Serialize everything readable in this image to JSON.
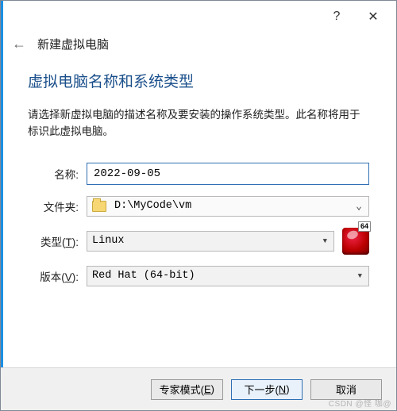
{
  "titlebar": {
    "help_glyph": "?",
    "close_glyph": "✕"
  },
  "header": {
    "back_glyph": "←",
    "title": "新建虚拟电脑"
  },
  "heading": "虚拟电脑名称和系统类型",
  "description": "请选择新虚拟电脑的描述名称及要安装的操作系统类型。此名称将用于标识此虚拟电脑。",
  "form": {
    "name_label": "名称:",
    "name_value": "2022-09-05",
    "folder_label": "文件夹:",
    "folder_value": "D:\\MyCode\\vm",
    "type_label_pre": "类型(",
    "type_hotkey": "T",
    "type_label_post": "):",
    "type_value": "Linux",
    "version_label_pre": "版本(",
    "version_hotkey": "V",
    "version_label_post": "):",
    "version_value": "Red Hat (64-bit)",
    "bits_badge": "64"
  },
  "footer": {
    "expert_pre": "专家模式(",
    "expert_hotkey": "E",
    "expert_post": ")",
    "next_pre": "下一步(",
    "next_hotkey": "N",
    "next_post": ")",
    "cancel": "取消"
  },
  "watermark": "CSDN @怪 咖@",
  "watermark2": ""
}
